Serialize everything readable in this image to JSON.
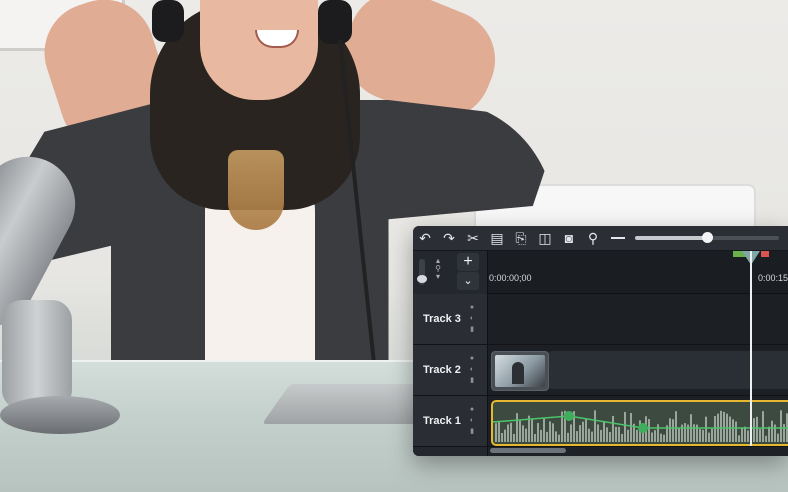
{
  "editor": {
    "toolbar": {
      "icons": [
        "undo-icon",
        "redo-icon",
        "cut-icon",
        "copy-icon",
        "paste-icon",
        "split-icon",
        "snapshot-icon",
        "zoom-icon"
      ],
      "zoom_level": 0.5
    },
    "timeline": {
      "start_time": "0:00:00;00",
      "end_time_partial": "0:00:15",
      "add_track": "+",
      "collapse": "⌄"
    },
    "tracks": [
      {
        "label": "Track 3"
      },
      {
        "label": "Track 2"
      },
      {
        "label": "Track 1"
      }
    ],
    "colors": {
      "accent_audio_border": "#e6b830",
      "marker_green": "#6ab04c",
      "marker_red": "#d9534f"
    }
  }
}
